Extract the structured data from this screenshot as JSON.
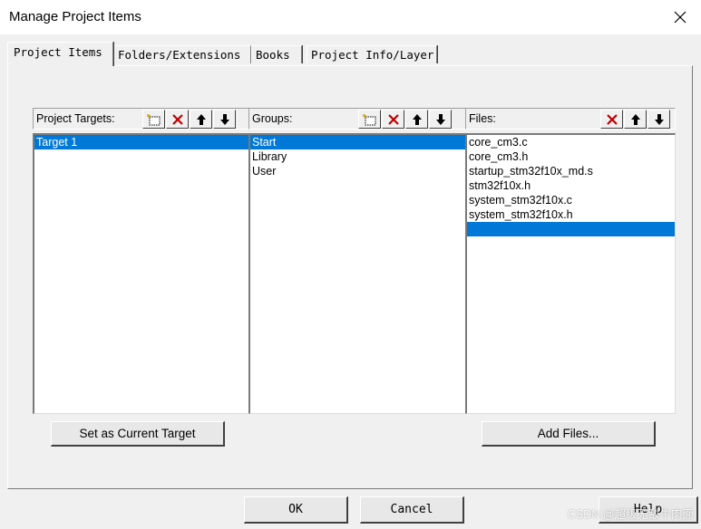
{
  "window": {
    "title": "Manage Project Items"
  },
  "tabs": [
    {
      "label": "Project Items",
      "active": true
    },
    {
      "label": "Folders/Extensions",
      "active": false
    },
    {
      "label": "Books",
      "active": false
    },
    {
      "label": "Project Info/Layer",
      "active": false
    }
  ],
  "targets": {
    "label": "Project Targets:",
    "items": [
      "Target 1"
    ],
    "selected_index": 0,
    "button_label": "Set as Current Target"
  },
  "groups": {
    "label": "Groups:",
    "items": [
      "Start",
      "Library",
      "User"
    ],
    "selected_index": 0
  },
  "files": {
    "label": "Files:",
    "items": [
      "core_cm3.c",
      "core_cm3.h",
      "startup_stm32f10x_md.s",
      "stm32f10x.h",
      "system_stm32f10x.c",
      "system_stm32f10x.h",
      ""
    ],
    "selected_index": 6,
    "button_label": "Add Files..."
  },
  "footer": {
    "ok_label": "OK",
    "cancel_label": "Cancel",
    "help_label": "Help"
  },
  "watermark": "CSDN @超级无敌牛肉面",
  "icons": {
    "new": "new-item-icon",
    "delete": "delete-icon",
    "up": "arrow-up-icon",
    "down": "arrow-down-icon",
    "close": "close-icon"
  },
  "colors": {
    "selection": "#0078d7",
    "delete_red": "#c00000",
    "dialog_bg": "#f0f0f0"
  }
}
